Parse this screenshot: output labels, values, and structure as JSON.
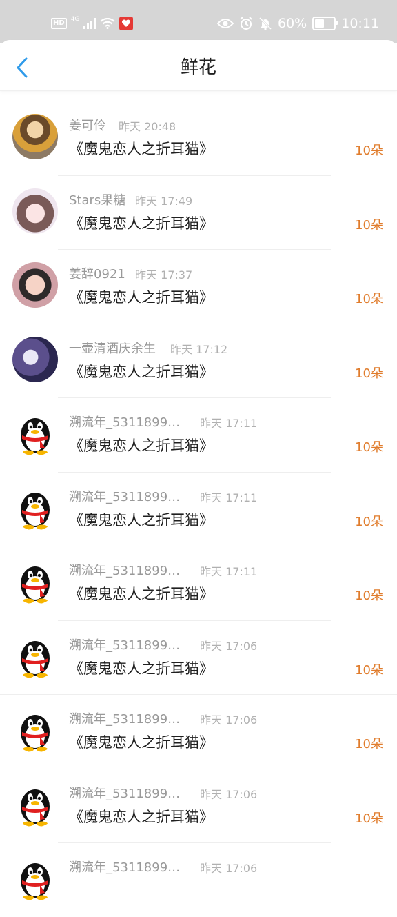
{
  "status_bar": {
    "hd": "HD",
    "network": "4G",
    "battery_percent": "60%",
    "time": "10:11",
    "battery_level": 0.6
  },
  "header": {
    "title": "鲜花"
  },
  "items": [
    {
      "name": "姜可伶",
      "time": "昨天 20:48",
      "book": "《魔鬼恋人之折耳猫》",
      "count": "10朵",
      "avatar": "photo-a0"
    },
    {
      "name": "Stars果糖",
      "time": "昨天 17:49",
      "book": "《魔鬼恋人之折耳猫》",
      "count": "10朵",
      "avatar": "photo-a1"
    },
    {
      "name": "姜辞0921",
      "time": "昨天 17:37",
      "book": "《魔鬼恋人之折耳猫》",
      "count": "10朵",
      "avatar": "photo-a2"
    },
    {
      "name": "一壶清酒庆余生",
      "time": "昨天 17:12",
      "book": "《魔鬼恋人之折耳猫》",
      "count": "10朵",
      "avatar": "photo-a3"
    },
    {
      "name": "溯流年_53118995...",
      "time": "昨天 17:11",
      "book": "《魔鬼恋人之折耳猫》",
      "count": "10朵",
      "avatar": "penguin"
    },
    {
      "name": "溯流年_53118995...",
      "time": "昨天 17:11",
      "book": "《魔鬼恋人之折耳猫》",
      "count": "10朵",
      "avatar": "penguin"
    },
    {
      "name": "溯流年_53118995...",
      "time": "昨天 17:11",
      "book": "《魔鬼恋人之折耳猫》",
      "count": "10朵",
      "avatar": "penguin"
    },
    {
      "name": "溯流年_53118995...",
      "time": "昨天 17:06",
      "book": "《魔鬼恋人之折耳猫》",
      "count": "10朵",
      "avatar": "penguin"
    },
    {
      "name": "溯流年_53118995...",
      "time": "昨天 17:06",
      "book": "《魔鬼恋人之折耳猫》",
      "count": "10朵",
      "avatar": "penguin"
    },
    {
      "name": "溯流年_53118995...",
      "time": "昨天 17:06",
      "book": "《魔鬼恋人之折耳猫》",
      "count": "10朵",
      "avatar": "penguin"
    },
    {
      "name": "溯流年_53118995...",
      "time": "昨天 17:06",
      "book": "",
      "count": "",
      "avatar": "penguin"
    }
  ],
  "colors": {
    "accent": "#2f9bea",
    "count": "#e07c2c",
    "status_bar": "#d6d6d6"
  }
}
